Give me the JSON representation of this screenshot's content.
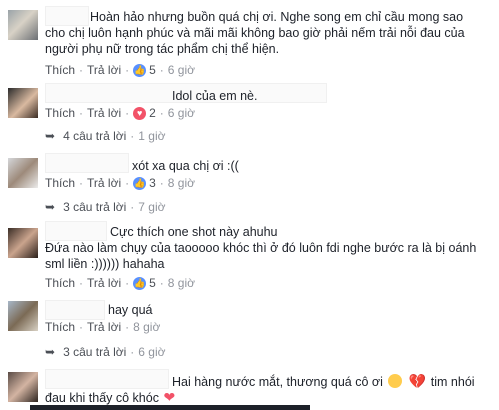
{
  "comments": [
    {
      "text_lines": [
        "Hoàn hảo nhưng buồn quá chị ơi. Nghe song em chỉ cầu mong sao",
        "cho chị luôn hạnh phúc và mãi mãi không bao giờ phải nếm trải nỗi đau của",
        "người phụ nữ trong tác phẩm chị thể hiện."
      ],
      "like": "Thích",
      "reply": "Trả lời",
      "reaction_count": "5",
      "time": "6 giờ"
    },
    {
      "text_lines": [
        "Idol của em nè."
      ],
      "like": "Thích",
      "reply": "Trả lời",
      "reaction_count": "2",
      "time": "6 giờ",
      "replies_label": "4 câu trả lời",
      "replies_time": "1 giờ"
    },
    {
      "text_lines": [
        "xót xa qua chị ơi :(("
      ],
      "like": "Thích",
      "reply": "Trả lời",
      "reaction_count": "3",
      "time": "8 giờ",
      "replies_label": "3 câu trả lời",
      "replies_time": "7 giờ"
    },
    {
      "text_lines": [
        "Cực thích one shot này ahuhu",
        "Đứa nào làm chụy của taooooo khóc thì ở đó luôn fdi nghe bước ra là bị oánh",
        "sml liền :)))))) hahaha"
      ],
      "like": "Thích",
      "reply": "Trả lời",
      "reaction_count": "5",
      "time": "8 giờ"
    },
    {
      "text_lines": [
        "hay quá"
      ],
      "like": "Thích",
      "reply": "Trả lời",
      "time": "8 giờ",
      "replies_label": "3 câu trả lời",
      "replies_time": "6 giờ"
    },
    {
      "text_lines": [
        "Hai hàng nước mắt, thương quá cô ơi",
        "tim nhói",
        "đau khi thấy cô khóc"
      ]
    }
  ],
  "colors": {
    "link": "#4b4f56",
    "meta": "#90949c",
    "like_reaction": "#5890ff",
    "love_reaction": "#f25268"
  }
}
